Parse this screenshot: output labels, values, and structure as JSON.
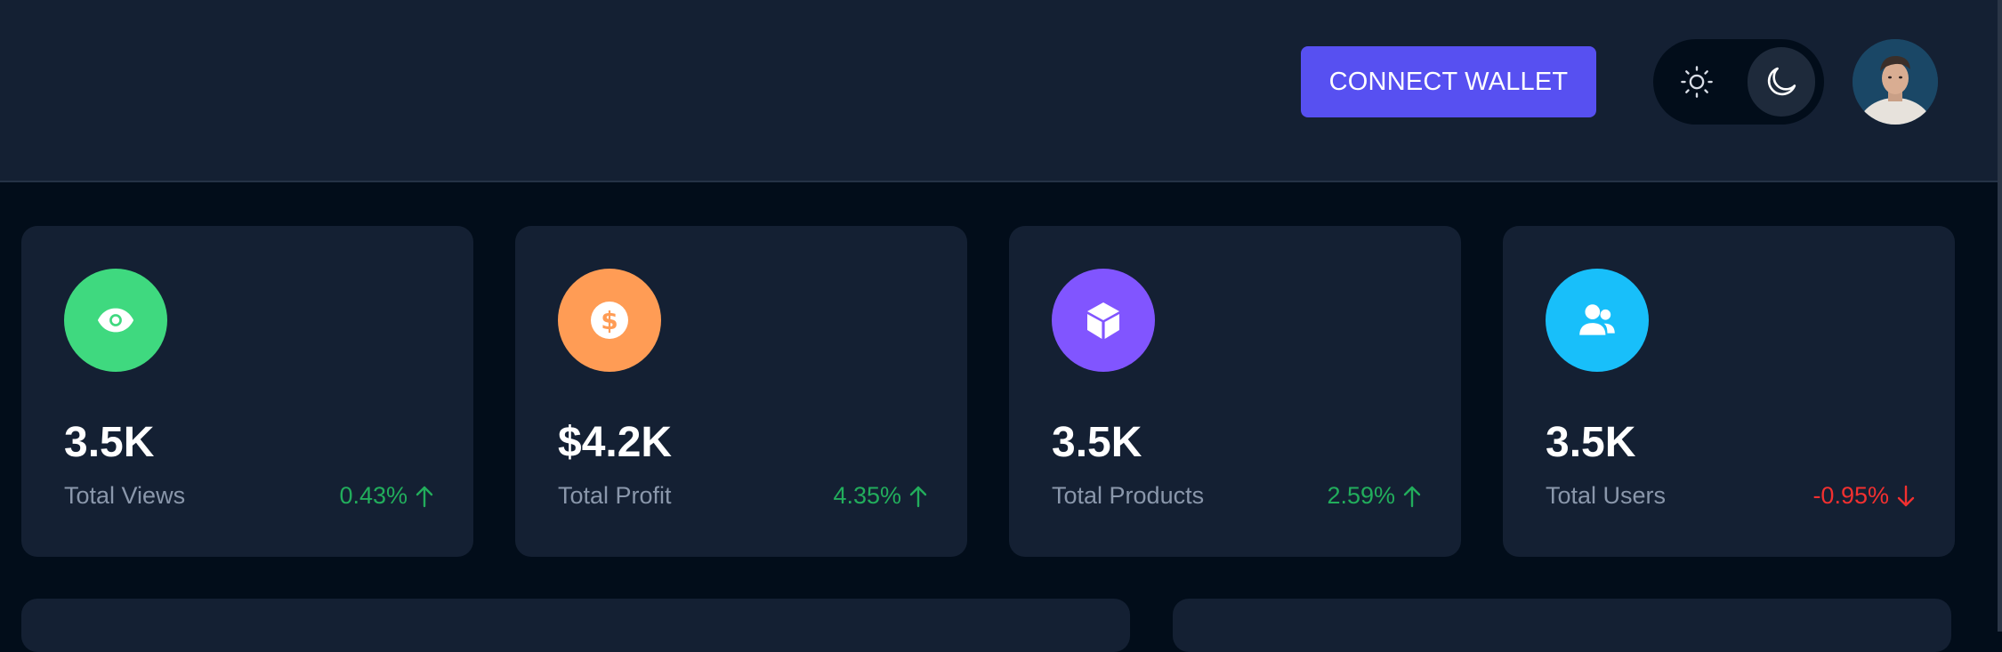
{
  "header": {
    "connect_wallet_label": "CONNECT WALLET",
    "theme": {
      "options": [
        "light-icon",
        "dark-icon"
      ],
      "active": "dark"
    }
  },
  "colors": {
    "accent": "#5750f1",
    "positive": "#22ad5c",
    "negative": "#f23030"
  },
  "stats": [
    {
      "icon": "eye-icon",
      "icon_bg": "#3fd97f",
      "value": "3.5K",
      "label": "Total Views",
      "change": "0.43%",
      "direction": "up"
    },
    {
      "icon": "dollar-icon",
      "icon_bg": "#ff9c55",
      "value": "$4.2K",
      "label": "Total Profit",
      "change": "4.35%",
      "direction": "up"
    },
    {
      "icon": "box-icon",
      "icon_bg": "#8155ff",
      "value": "3.5K",
      "label": "Total Products",
      "change": "2.59%",
      "direction": "up"
    },
    {
      "icon": "users-icon",
      "icon_bg": "#18bffa",
      "value": "3.5K",
      "label": "Total Users",
      "change": "-0.95%",
      "direction": "down"
    }
  ]
}
